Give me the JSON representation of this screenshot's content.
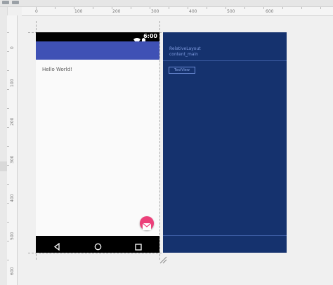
{
  "ruler_top": {
    "labels": [
      "0",
      "100",
      "200",
      "300",
      "400",
      "500",
      "600"
    ]
  },
  "ruler_left": {
    "labels": [
      "0",
      "100",
      "200",
      "300",
      "400",
      "500",
      "600"
    ]
  },
  "device": {
    "status_time": "6:00",
    "hello_text": "Hello World!",
    "icons": {
      "wifi": "wifi-icon",
      "battery": "battery-icon",
      "fab": "mail-icon",
      "back": "back-triangle-icon",
      "home": "home-circle-icon",
      "recents": "recents-square-icon"
    },
    "colors": {
      "app_bar": "#3f51b5",
      "fab": "#ec407a",
      "background": "#fafafa"
    }
  },
  "blueprint": {
    "layout_type": "RelativeLayout",
    "layout_id": "content_main",
    "textview_label": "TextView",
    "colors": {
      "background": "#15326e",
      "text": "#7f9be0"
    }
  }
}
